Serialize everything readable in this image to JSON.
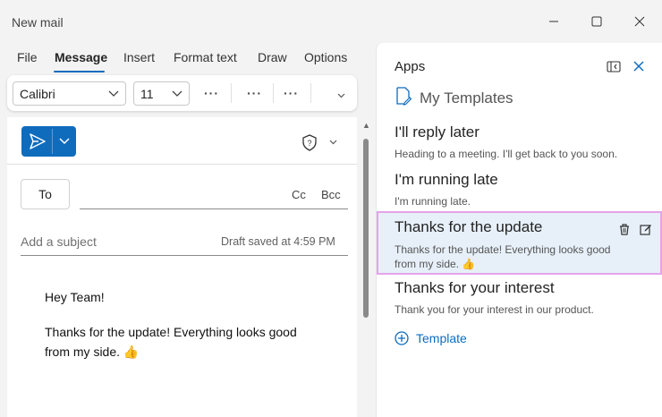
{
  "window": {
    "title": "New mail"
  },
  "menu": {
    "items": [
      {
        "label": "File"
      },
      {
        "label": "Message"
      },
      {
        "label": "Insert"
      },
      {
        "label": "Format text"
      },
      {
        "label": "Draw"
      },
      {
        "label": "Options"
      }
    ],
    "active": "Message"
  },
  "ribbon": {
    "font": "Calibri",
    "size": "11",
    "more": "···"
  },
  "compose": {
    "to_label": "To",
    "cc_label": "Cc",
    "bcc_label": "Bcc",
    "subject_placeholder": "Add a subject",
    "draft_status": "Draft saved at 4:59 PM",
    "body_greeting": "Hey Team!",
    "body_text": "Thanks for the update! Everything looks good from my side. 👍"
  },
  "apps": {
    "title": "Apps",
    "subtitle": "My Templates",
    "templates": [
      {
        "title": "I'll reply later",
        "text": "Heading to a meeting. I'll get back to you soon."
      },
      {
        "title": "I'm running late",
        "text": "I'm running late."
      },
      {
        "title": "Thanks for the update",
        "text": "Thanks for the update! Everything looks good from my side. 👍"
      },
      {
        "title": "Thanks for your interest",
        "text": "Thank you for your interest in our product."
      }
    ],
    "selected_index": 2,
    "add_label": "Template"
  },
  "colors": {
    "accent": "#0f6cbd",
    "selected_bg": "#e7f0f9",
    "selected_border": "#e4a3e8"
  }
}
